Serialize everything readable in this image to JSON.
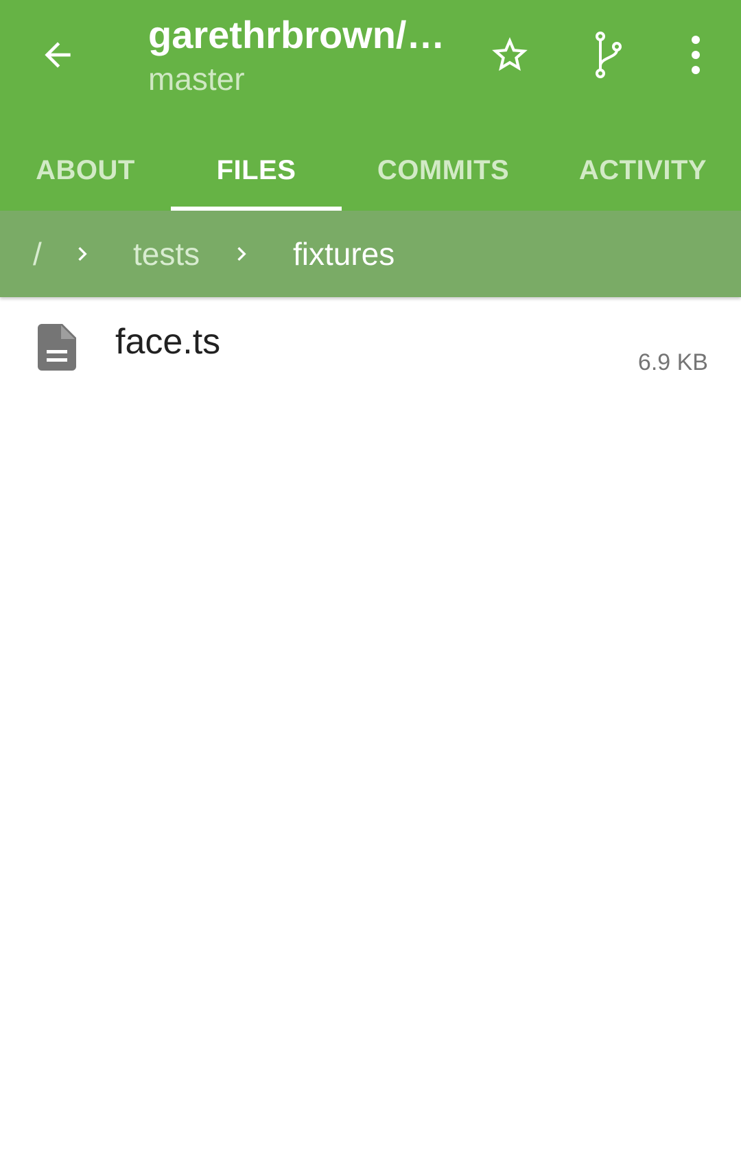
{
  "header": {
    "title": "garethrbrown/…",
    "subtitle": "master",
    "back_icon": "arrow-left-icon",
    "actions": [
      {
        "name": "star",
        "icon": "star-outline-icon"
      },
      {
        "name": "branch",
        "icon": "git-branch-icon"
      },
      {
        "name": "overflow",
        "icon": "more-vertical-icon"
      }
    ]
  },
  "tabs": [
    {
      "label": "ABOUT"
    },
    {
      "label": "FILES",
      "active": true
    },
    {
      "label": "COMMITS"
    },
    {
      "label": "ACTIVITY"
    }
  ],
  "breadcrumb": {
    "items": [
      {
        "label": "/"
      },
      {
        "label": "tests"
      },
      {
        "label": "fixtures"
      }
    ]
  },
  "files": [
    {
      "name": "face.ts",
      "size": "6.9 KB",
      "icon": "file-document-icon"
    }
  ],
  "colors": {
    "primary": "#66b345",
    "breadcrumb_bg": "#7aab66",
    "tab_inactive": "#d2eac6",
    "text_primary": "#212121",
    "text_secondary": "#757575"
  }
}
